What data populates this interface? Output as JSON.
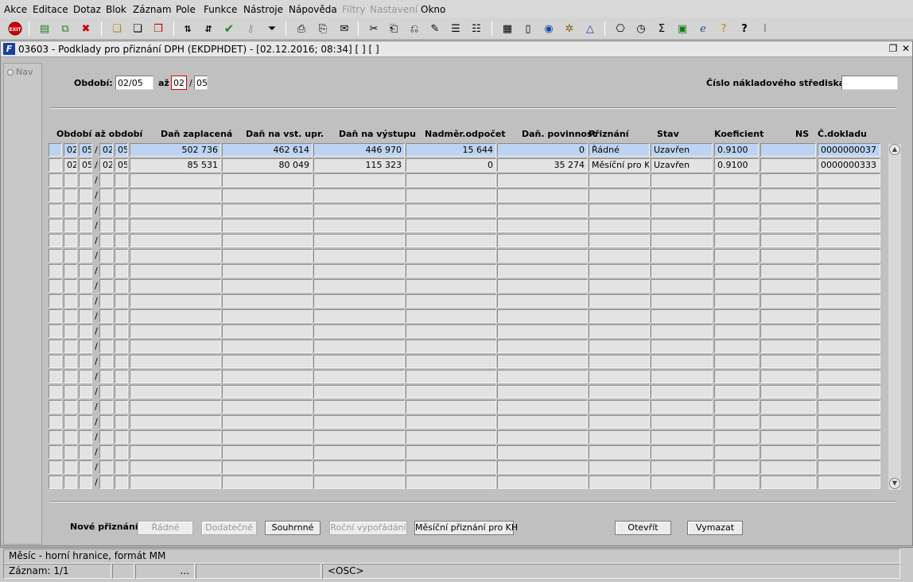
{
  "menu": [
    "Akce",
    "Editace",
    "Dotaz",
    "Blok",
    "Záznam",
    "Pole",
    "Funkce",
    "Nástroje",
    "Nápověda",
    "Filtry",
    "Nastavení",
    "Okno"
  ],
  "menu_disabled": [
    "Filtry",
    "Nastavení"
  ],
  "window": {
    "title": "03603 - Podklady pro přiznání DPH (EKDPHDET) - [02.12.2016; 08:34]  [ ]  [ ]"
  },
  "nav": {
    "label": "Nav"
  },
  "filter": {
    "obdobi_label": "Období:",
    "obdobi_value": "02/05",
    "az_label": "až",
    "az_year": "02",
    "az_sep": "/",
    "az_month": "05",
    "ns_label": "Číslo nákladového střediska",
    "ns_value": ""
  },
  "table": {
    "headers": {
      "obdobi_az_obdobi": "Období až období",
      "dan_zaplacena": "Daň zaplacená",
      "dan_na_vst_upr": "Daň na vst. upr.",
      "dan_na_vystupu": "Daň na výstupu",
      "nadmer_odpocet": "Nadměr.odpočet",
      "dan_povinnost": "Daň. povinnost",
      "priznani": "Přiznání",
      "stav": "Stav",
      "koeficient": "Koeficient",
      "ns": "NS",
      "c_dokladu": "Č.dokladu"
    },
    "rows": [
      {
        "r1": "02",
        "m1": "05",
        "r2": "02",
        "m2": "05",
        "dan_zaplacena": "502 736",
        "dan_na_vst_upr": "462 614",
        "dan_na_vystupu": "446 970",
        "nadmer_odpocet": "15 644",
        "dan_povinnost": "0",
        "priznani": "Řádné",
        "stav": "Uzavřen",
        "koeficient": "0.9100",
        "ns": "",
        "c_dokladu": "0000000037"
      },
      {
        "r1": "02",
        "m1": "05",
        "r2": "02",
        "m2": "05",
        "dan_zaplacena": "85 531",
        "dan_na_vst_upr": "80 049",
        "dan_na_vystupu": "115 323",
        "nadmer_odpocet": "0",
        "dan_povinnost": "35 274",
        "priznani": "Měsíční pro KH",
        "stav": "Uzavřen",
        "koeficient": "0.9100",
        "ns": "",
        "c_dokladu": "0000000333"
      }
    ],
    "visible_rows": 23,
    "separator": "/"
  },
  "buttons": {
    "nove_priznani_label": "Nové přiznání",
    "radne": "Řádné",
    "dodatecne": "Dodatečné",
    "souhrnne": "Souhrnné",
    "rocni": "Roční vypořádání",
    "mesicni_kh": "Měsíční přiznání pro KH",
    "otevrit": "Otevřít",
    "vymazat": "Vymazat"
  },
  "status": {
    "hint": "Měsíc - horní hranice, formát MM",
    "zaznam": "Záznam: 1/1",
    "dots": "...",
    "osc": "<OSC>"
  },
  "colors": {
    "selected_row": "#bcd4f2",
    "title_bg": "#e8e8e8",
    "field_bg": "#e3e3e3"
  }
}
